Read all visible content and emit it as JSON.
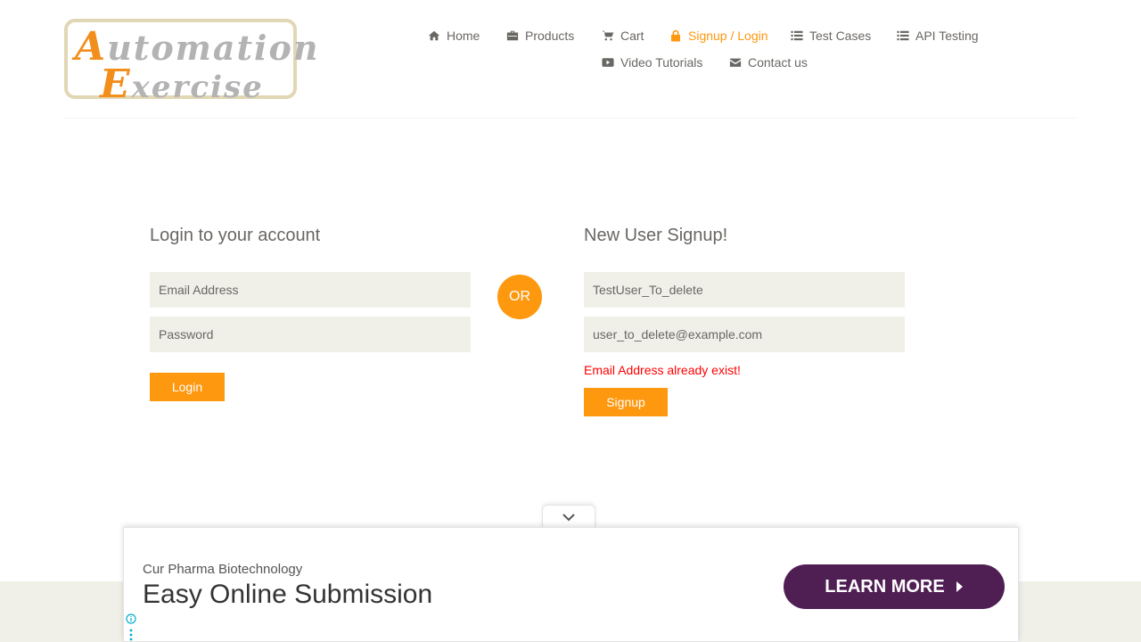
{
  "logo": {
    "line1_cap": "A",
    "line1_rest": "utomation",
    "line2_cap": "E",
    "line2_rest": "xercise"
  },
  "nav": {
    "items": [
      {
        "label": "Home",
        "icon": "home-icon"
      },
      {
        "label": "Products",
        "icon": "briefcase-icon"
      },
      {
        "label": "Cart",
        "icon": "cart-icon"
      },
      {
        "label": "Signup / Login",
        "icon": "lock-icon",
        "active": true
      },
      {
        "label": "Test Cases",
        "icon": "list-icon"
      },
      {
        "label": "API Testing",
        "icon": "list-icon"
      },
      {
        "label": "Video Tutorials",
        "icon": "youtube-play-icon"
      },
      {
        "label": "Contact us",
        "icon": "envelope-icon"
      }
    ]
  },
  "login": {
    "title": "Login to your account",
    "email_placeholder": "Email Address",
    "password_placeholder": "Password",
    "button_label": "Login"
  },
  "or_label": "OR",
  "signup": {
    "title": "New User Signup!",
    "name_value": "TestUser_To_delete",
    "email_value": "user_to_delete@example.com",
    "error": "Email Address already exist!",
    "button_label": "Signup"
  },
  "ad": {
    "sponsor": "Cur Pharma Biotechnology",
    "headline": "Easy Online Submission",
    "cta_label": "LEARN MORE"
  },
  "colors": {
    "accent": "#fe980f",
    "error": "#ff0000",
    "input_bg": "#f0f0e9",
    "ad_cta": "#4f1f54"
  }
}
